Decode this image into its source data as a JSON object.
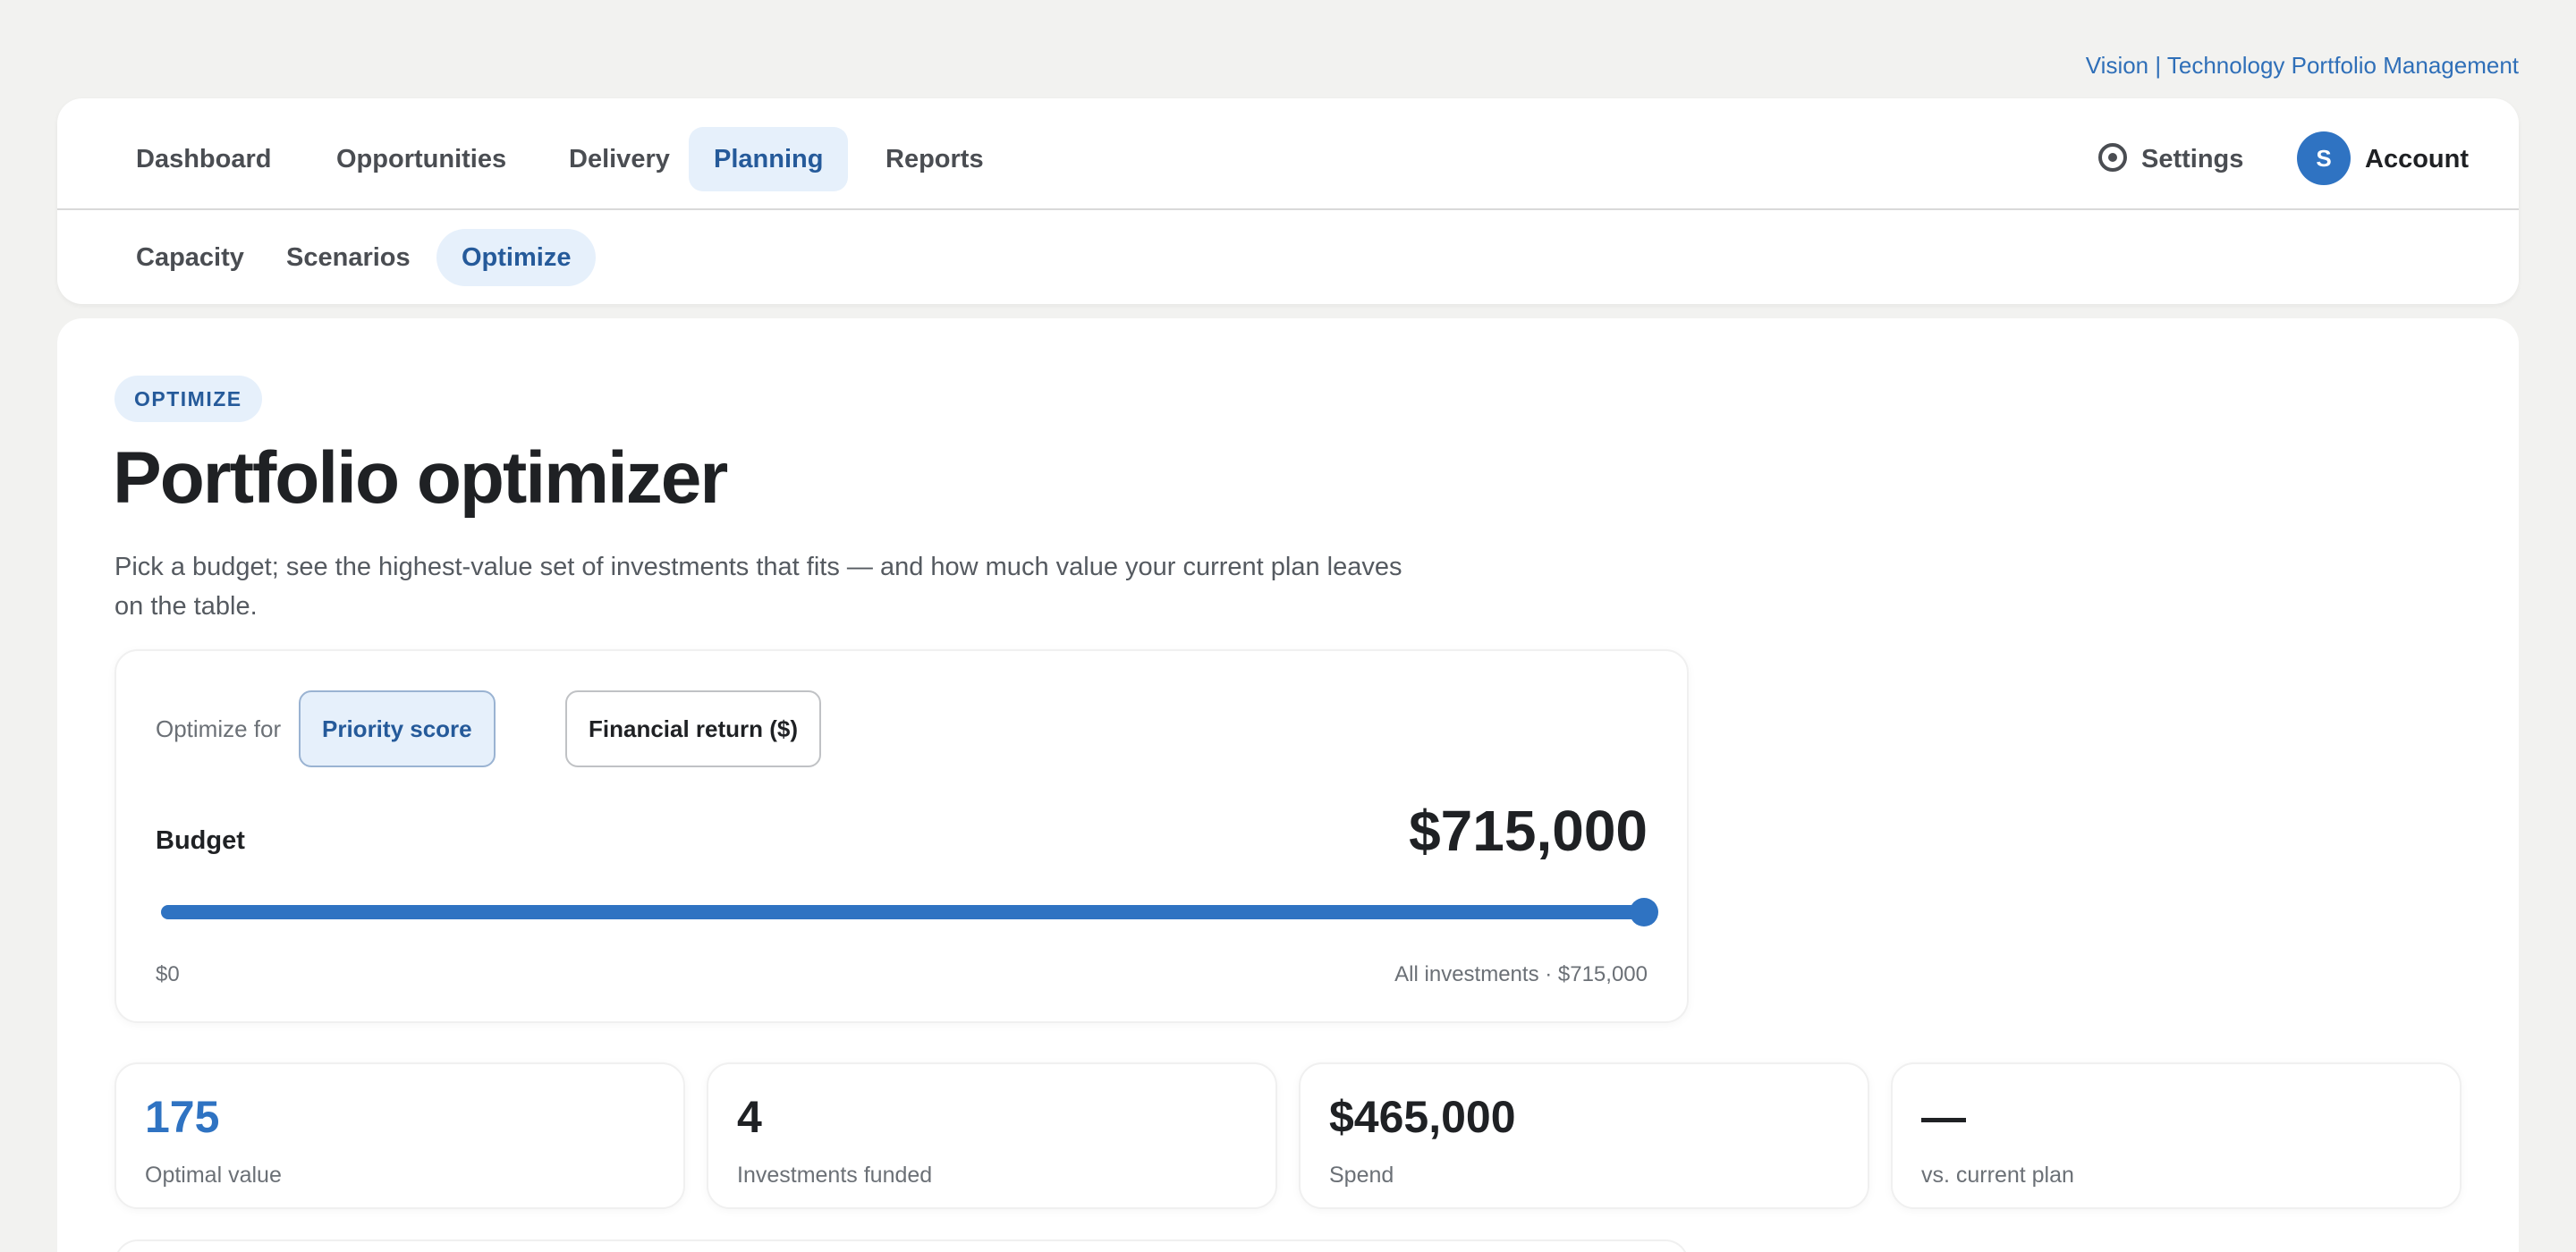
{
  "header": {
    "top_link": "Vision | Technology Portfolio Management"
  },
  "nav": {
    "tabs": [
      {
        "label": "Dashboard",
        "active": false
      },
      {
        "label": "Opportunities",
        "active": false
      },
      {
        "label": "Delivery",
        "active": false
      },
      {
        "label": "Planning",
        "active": true
      },
      {
        "label": "Reports",
        "active": false
      }
    ],
    "settings_label": "Settings",
    "settings_icon": "settings-icon",
    "avatar_initial": "S",
    "account_label": "Account",
    "subtabs": [
      {
        "label": "Capacity",
        "active": false
      },
      {
        "label": "Scenarios",
        "active": false
      },
      {
        "label": "Optimize",
        "active": true
      }
    ]
  },
  "page": {
    "badge": "OPTIMIZE",
    "title": "Portfolio optimizer",
    "description": "Pick a budget; see the highest-value set of investments that fits — and how much value your current plan leaves on the table."
  },
  "optimizer": {
    "optimize_for_label": "Optimize for",
    "options": [
      {
        "label": "Priority score",
        "active": true
      },
      {
        "label": "Financial return ($)",
        "active": false
      }
    ],
    "budget_label": "Budget",
    "budget_value": "$715,000",
    "slider": {
      "fraction": 1.0,
      "min_label": "$0",
      "max_label": "All investments · $715,000"
    }
  },
  "stats": [
    {
      "value": "175",
      "label": "Optimal value",
      "accent": true
    },
    {
      "value": "4",
      "label": "Investments funded",
      "accent": false
    },
    {
      "value": "$465,000",
      "label": "Spend",
      "accent": false
    },
    {
      "value": "—",
      "label": "vs. current plan",
      "accent": false
    }
  ],
  "colors": {
    "accent": "#2f73c2",
    "accent_soft": "#e6f0fb",
    "background": "#f2f2f0"
  }
}
